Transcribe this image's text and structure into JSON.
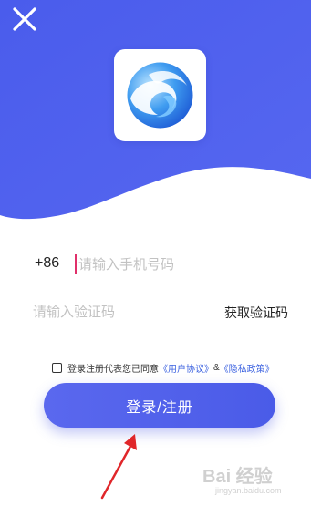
{
  "colors": {
    "hero_blue": "#4f60ee",
    "button_blue": "#5060ea",
    "link_blue": "#3d63e0",
    "caret_pink": "#e0306a",
    "arrow_red": "#e0262a"
  },
  "header": {
    "close_icon": "close-icon"
  },
  "logo": {
    "icon": "swirl-logo-icon"
  },
  "login_form": {
    "country_code": "+86",
    "phone_placeholder": "请输入手机号码",
    "phone_value": "",
    "code_placeholder": "请输入验证码",
    "code_value": "",
    "get_code_label": "获取验证码"
  },
  "agreement": {
    "checked": false,
    "text": "登录注册代表您已同意",
    "user_agreement": "《用户协议》",
    "ampersand": "&",
    "privacy_policy": "《隐私政策》"
  },
  "submit": {
    "label": "登录/注册"
  },
  "watermark": {
    "text": "Bai 经验",
    "sub": "jingyan.baidu.com"
  }
}
